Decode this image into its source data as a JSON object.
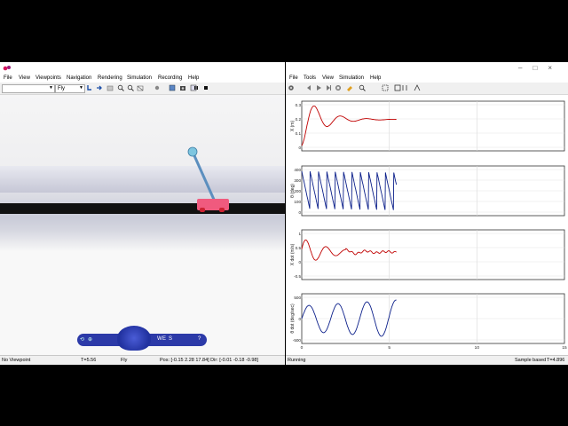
{
  "vr": {
    "menu": [
      "File",
      "View",
      "Viewpoints",
      "Navigation",
      "Rendering",
      "Simulation",
      "Recording",
      "Help"
    ],
    "nav_mode": "Fly",
    "status": {
      "viewpoint": "No Viewpoint",
      "time": "T=5.56",
      "mode": "Fly",
      "pos_dir": "Pos: [-0.15 2.28 17.84] Dir: [-0.01 -0.18 -0.98]"
    },
    "nav_panel_buttons": [
      "W",
      "E",
      "S"
    ]
  },
  "scope": {
    "menu": [
      "File",
      "Tools",
      "View",
      "Simulation",
      "Help"
    ],
    "status": {
      "state": "Running",
      "mode": "Sample based",
      "time": "T=4.896"
    },
    "x_ticks": [
      "0",
      "5",
      "10",
      "15"
    ],
    "plots": [
      {
        "ylabel": "X (m)",
        "yticks": [
          "0.3",
          "0.2",
          "0.1",
          "0"
        ],
        "color": "#c00000"
      },
      {
        "ylabel": "θ (deg)",
        "yticks": [
          "400",
          "300",
          "200",
          "100",
          "0"
        ],
        "color": "#0b1f8a"
      },
      {
        "ylabel": "X dot (m/s)",
        "yticks": [
          "1",
          "0.5",
          "0",
          "-0.5"
        ],
        "color": "#c00000"
      },
      {
        "ylabel": "θ dot (deg/sec)",
        "yticks": [
          "500",
          "0",
          "-500"
        ],
        "color": "#0b1f8a"
      }
    ]
  }
}
